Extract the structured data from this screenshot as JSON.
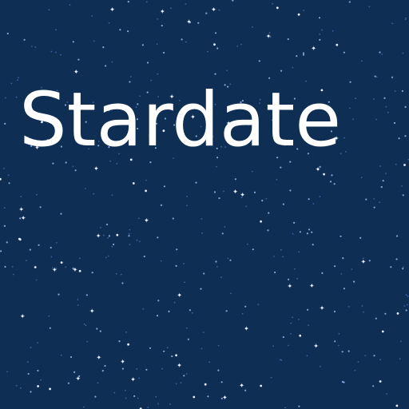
{
  "app": {
    "title": "Stardate"
  },
  "colors": {
    "background": "#0e2e53",
    "title_text": "#ffffff",
    "star_bright": "#e6f0ff",
    "star_mid": "#8fb4e8",
    "star_dim": "#3f6fb0"
  }
}
